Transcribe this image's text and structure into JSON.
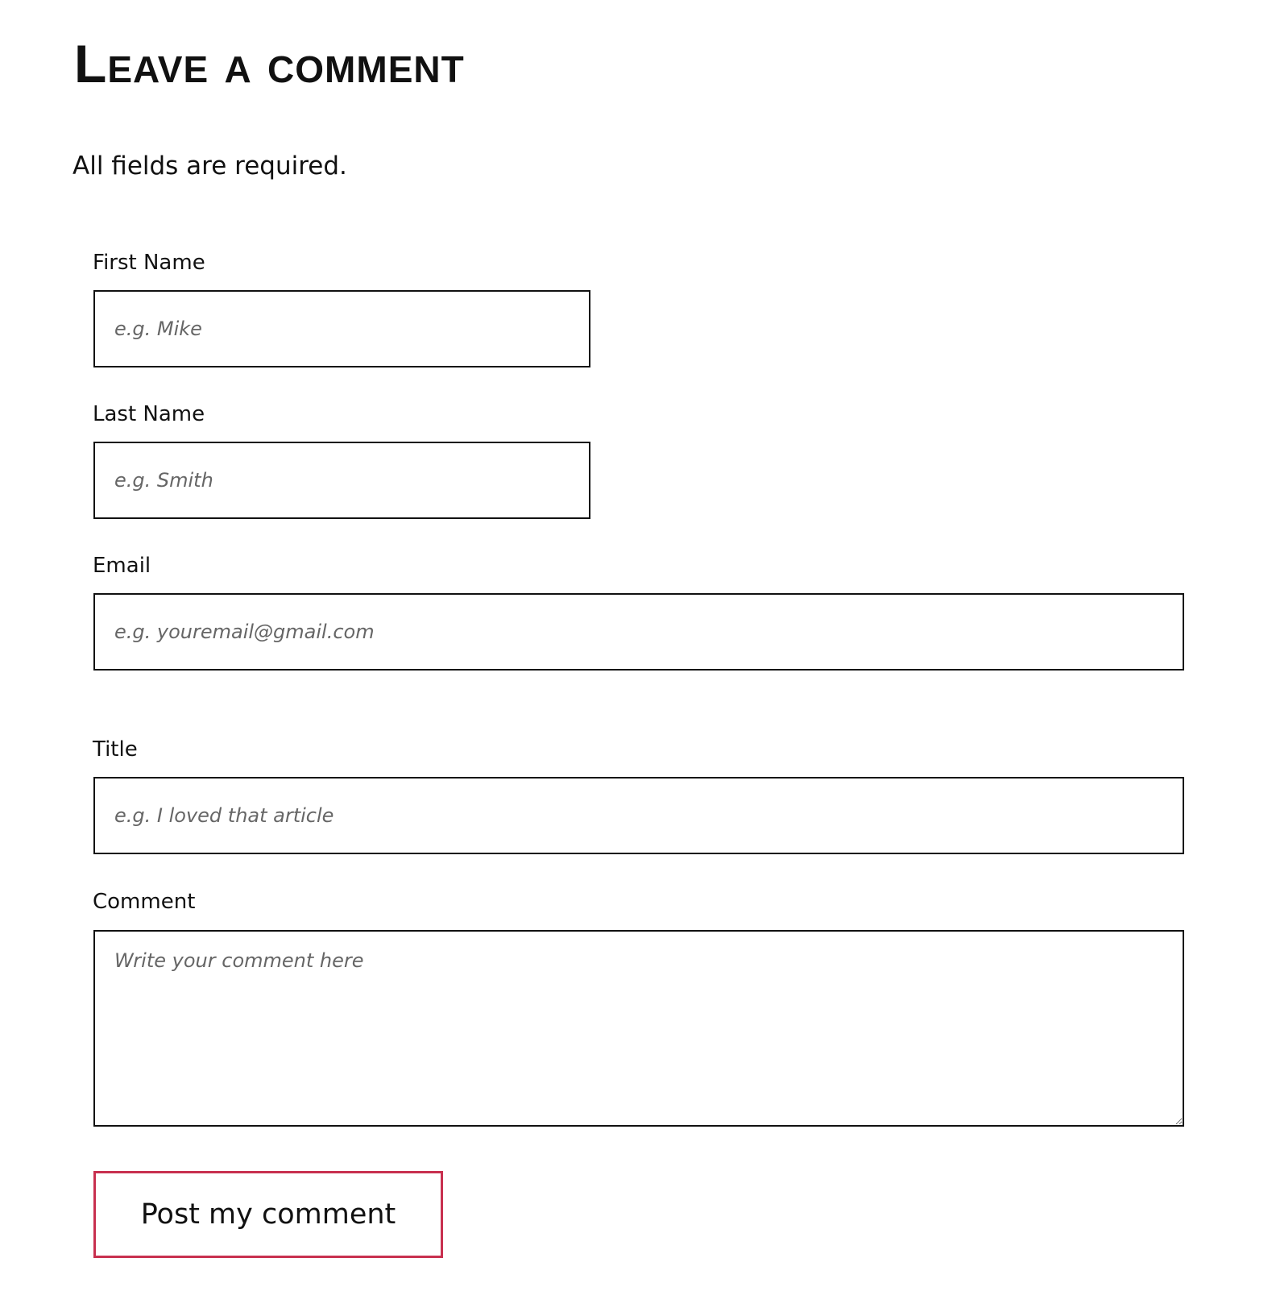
{
  "heading": "Leave a comment",
  "required_note": "All fields are required.",
  "fields": {
    "first_name": {
      "label": "First Name",
      "placeholder": "e.g. Mike",
      "value": ""
    },
    "last_name": {
      "label": "Last Name",
      "placeholder": "e.g. Smith",
      "value": ""
    },
    "email": {
      "label": "Email",
      "placeholder": "e.g. youremail@gmail.com",
      "value": ""
    },
    "title": {
      "label": "Title",
      "placeholder": "e.g. I loved that article",
      "value": ""
    },
    "comment": {
      "label": "Comment",
      "placeholder": "Write your comment here",
      "value": ""
    }
  },
  "submit_label": "Post my comment",
  "colors": {
    "text": "#111111",
    "placeholder": "#666666",
    "input_border": "#111111",
    "button_border": "#c8304f",
    "background": "#ffffff"
  }
}
